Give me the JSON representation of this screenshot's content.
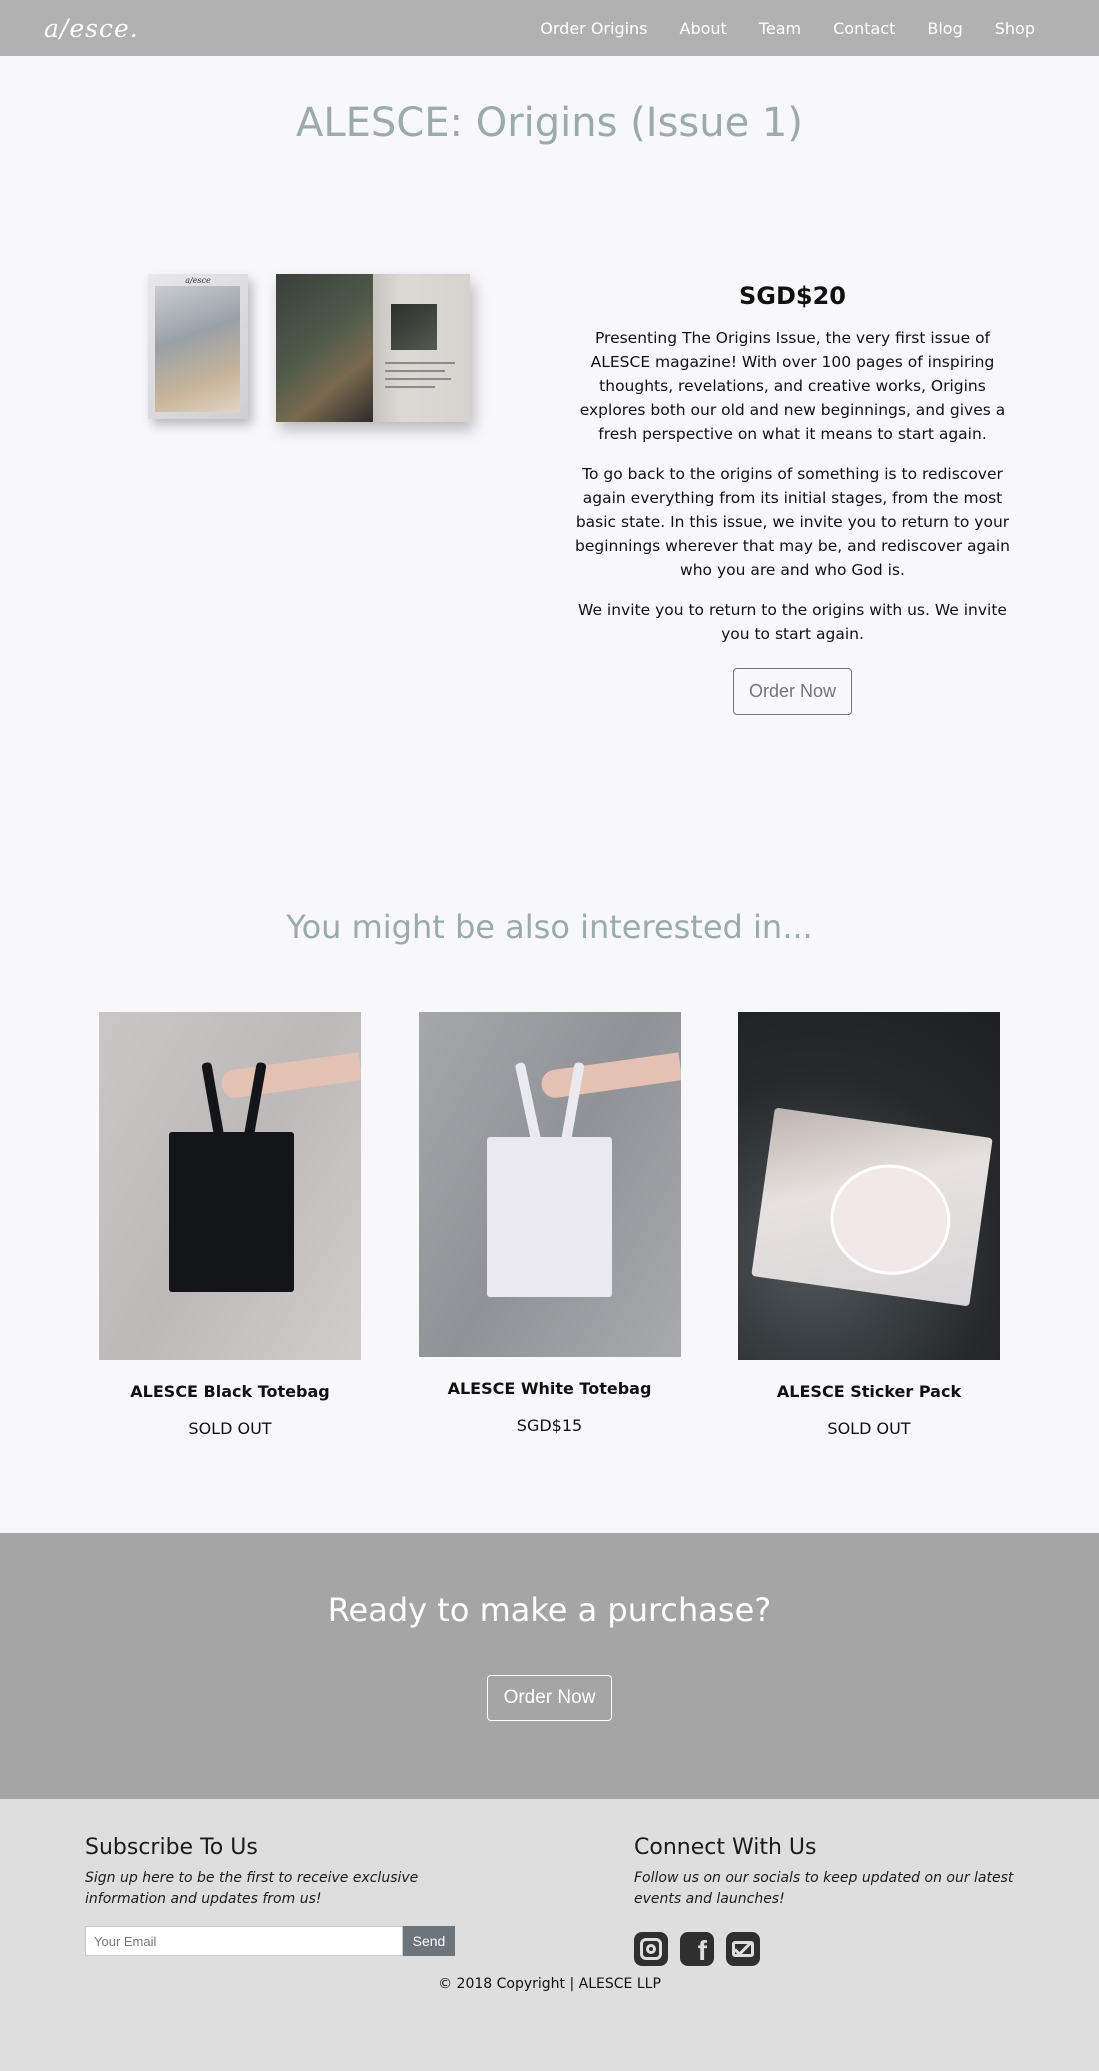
{
  "nav": {
    "logo": "a/esce.",
    "links": [
      "Order Origins",
      "About",
      "Team",
      "Contact",
      "Blog",
      "Shop"
    ]
  },
  "product": {
    "title": "ALESCE: Origins (Issue 1)",
    "price": "SGD$20",
    "paragraphs": [
      "Presenting The Origins Issue, the very first issue of ALESCE magazine! With over 100 pages of inspiring thoughts, revelations, and creative works, Origins explores both our old and new beginnings, and gives a fresh perspective on what it means to start again.",
      "To go back to the origins of something is to rediscover again everything from its initial stages, from the most basic state. In this issue, we invite you to return to your beginnings wherever that may be, and rediscover again who you are and who God is.",
      "We invite you to return to the origins with us. We invite you to start again."
    ],
    "order_button": "Order Now",
    "cover_text": "a/esce"
  },
  "related": {
    "title": "You might be also interested in...",
    "items": [
      {
        "name": "ALESCE Black Totebag",
        "price": "SOLD OUT"
      },
      {
        "name": "ALESCE White Totebag",
        "price": "SGD$15"
      },
      {
        "name": "ALESCE Sticker Pack",
        "price": "SOLD OUT"
      }
    ]
  },
  "cta": {
    "title": "Ready to make a purchase?",
    "button": "Order Now"
  },
  "footer": {
    "subscribe_title": "Subscribe To Us",
    "subscribe_text": "Sign up here to be the first to receive exclusive information and updates from us!",
    "email_placeholder": "Your Email",
    "send_button": "Send",
    "connect_title": "Connect With Us",
    "connect_text": "Follow us on our socials to keep updated on our latest events and launches!",
    "social_icons": [
      "instagram-icon",
      "facebook-icon",
      "email-icon"
    ],
    "copyright": "© 2018 Copyright | ALESCE LLP"
  }
}
